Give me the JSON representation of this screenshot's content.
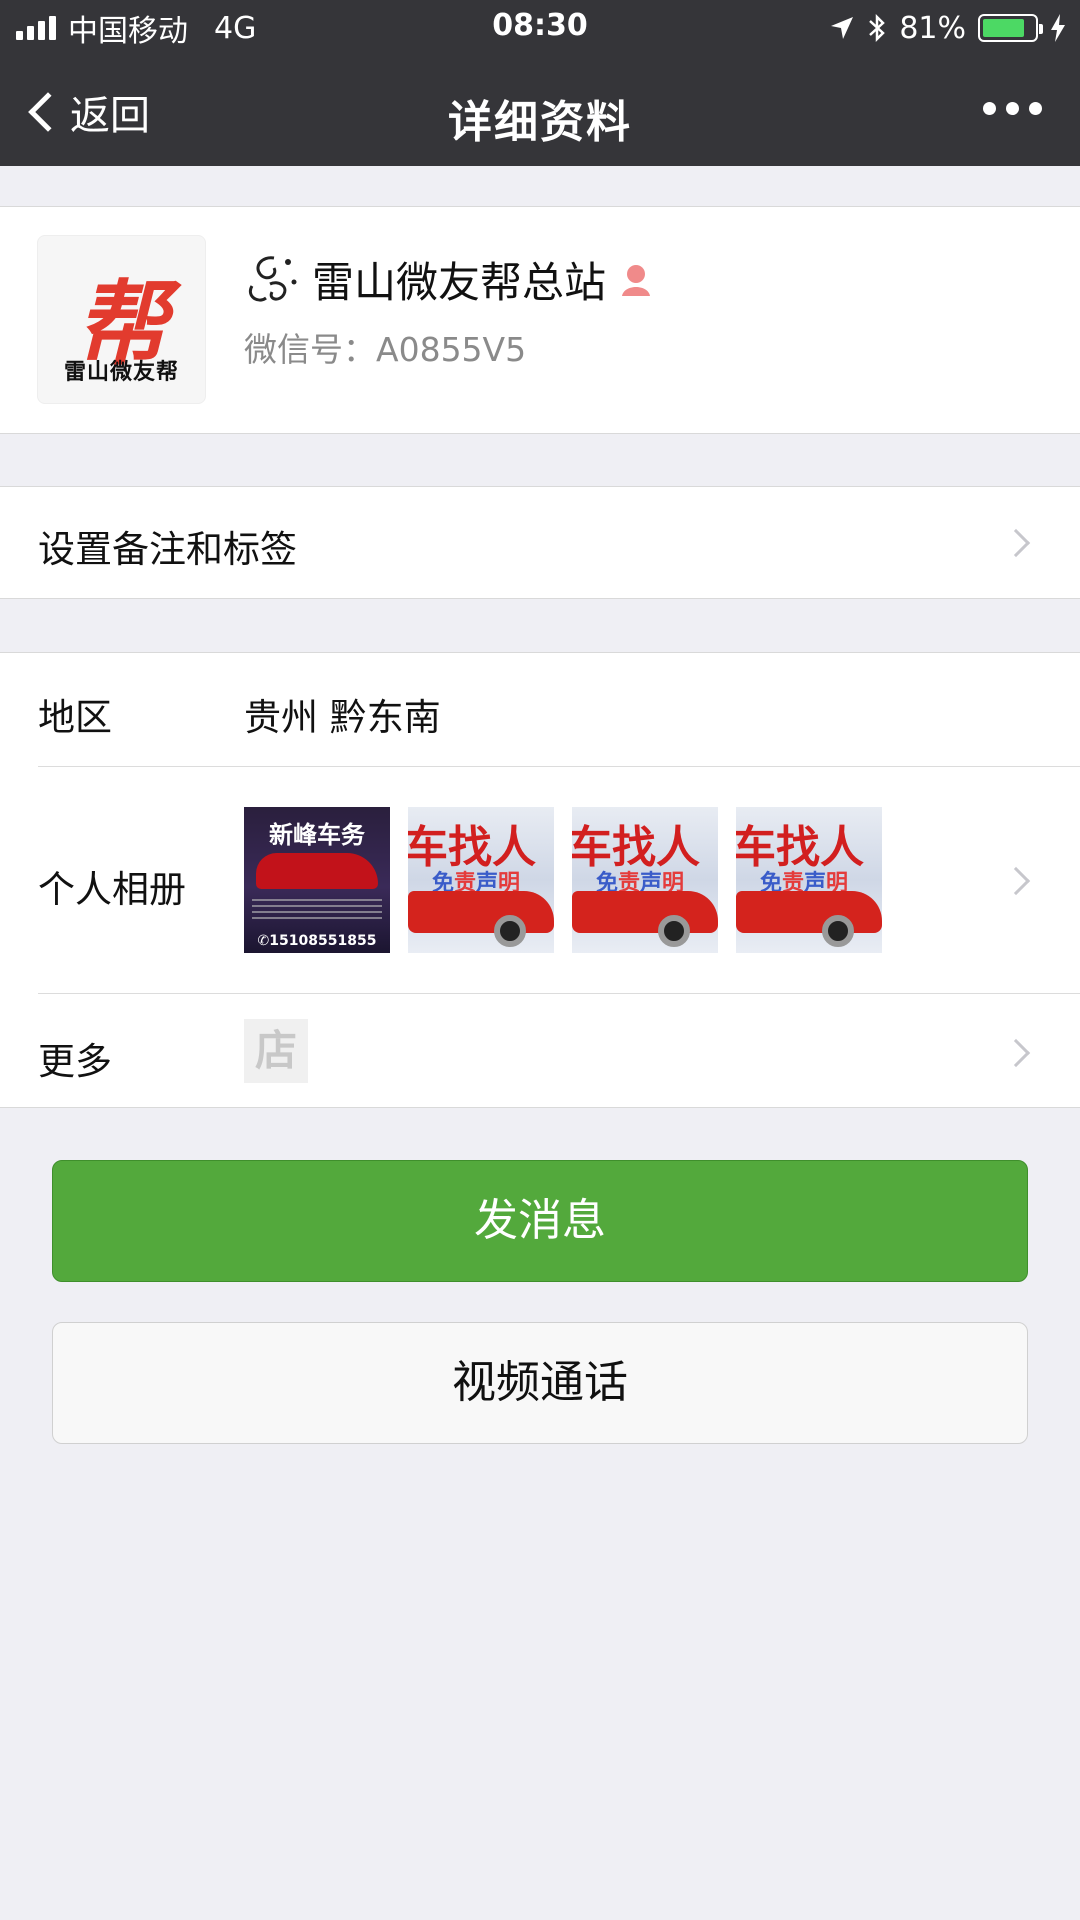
{
  "status_bar": {
    "carrier": "中国移动",
    "network": "4G",
    "time": "08:30",
    "battery_percent": "81%",
    "battery_level": 0.81,
    "battery_color": "#4cd964"
  },
  "nav": {
    "back_label": "返回",
    "title": "详细资料",
    "more_icon": "ellipsis-icon"
  },
  "profile": {
    "avatar_big_char": "帮",
    "avatar_text": "雷山微友帮",
    "name": "雷山微友帮总站",
    "wechat_id": "微信号：A0855V5",
    "gender_icon": "female-icon"
  },
  "remark": {
    "label": "设置备注和标签"
  },
  "info": {
    "region_label": "地区",
    "region_value": "贵州 黔东南",
    "album_label": "个人相册",
    "album": [
      {
        "title": "新峰车务",
        "phone": "✆15108551855"
      },
      {
        "headline": "车找人",
        "sub_blue": "免",
        "sub_red": "责",
        "sub_blue2": "声",
        "sub_red2": "明"
      },
      {
        "headline": "车找人",
        "sub_blue": "免",
        "sub_red": "责",
        "sub_blue2": "声",
        "sub_red2": "明"
      },
      {
        "headline": "车找人",
        "sub_blue": "免",
        "sub_red": "责",
        "sub_blue2": "声",
        "sub_red2": "明"
      }
    ],
    "more_label": "更多",
    "shop_char": "店"
  },
  "buttons": {
    "send_message": "发消息",
    "video_call": "视频通话"
  },
  "colors": {
    "nav_bg": "#353539",
    "primary_green": "#53a93c",
    "page_bg": "#efeff4"
  }
}
